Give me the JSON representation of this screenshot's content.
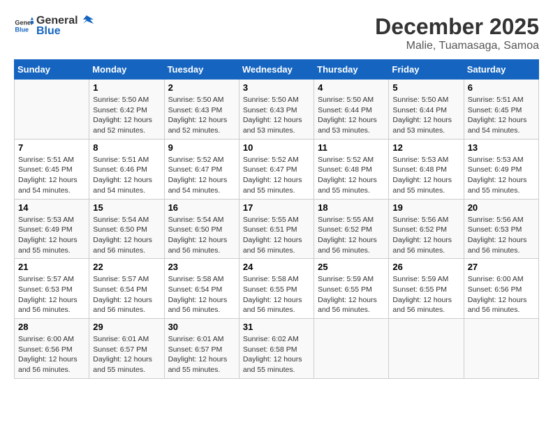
{
  "logo": {
    "text_general": "General",
    "text_blue": "Blue"
  },
  "title": "December 2025",
  "subtitle": "Malie, Tuamasaga, Samoa",
  "days_header": [
    "Sunday",
    "Monday",
    "Tuesday",
    "Wednesday",
    "Thursday",
    "Friday",
    "Saturday"
  ],
  "weeks": [
    [
      {
        "day": "",
        "info": ""
      },
      {
        "day": "1",
        "info": "Sunrise: 5:50 AM\nSunset: 6:42 PM\nDaylight: 12 hours\nand 52 minutes."
      },
      {
        "day": "2",
        "info": "Sunrise: 5:50 AM\nSunset: 6:43 PM\nDaylight: 12 hours\nand 52 minutes."
      },
      {
        "day": "3",
        "info": "Sunrise: 5:50 AM\nSunset: 6:43 PM\nDaylight: 12 hours\nand 53 minutes."
      },
      {
        "day": "4",
        "info": "Sunrise: 5:50 AM\nSunset: 6:44 PM\nDaylight: 12 hours\nand 53 minutes."
      },
      {
        "day": "5",
        "info": "Sunrise: 5:50 AM\nSunset: 6:44 PM\nDaylight: 12 hours\nand 53 minutes."
      },
      {
        "day": "6",
        "info": "Sunrise: 5:51 AM\nSunset: 6:45 PM\nDaylight: 12 hours\nand 54 minutes."
      }
    ],
    [
      {
        "day": "7",
        "info": "Sunrise: 5:51 AM\nSunset: 6:45 PM\nDaylight: 12 hours\nand 54 minutes."
      },
      {
        "day": "8",
        "info": "Sunrise: 5:51 AM\nSunset: 6:46 PM\nDaylight: 12 hours\nand 54 minutes."
      },
      {
        "day": "9",
        "info": "Sunrise: 5:52 AM\nSunset: 6:47 PM\nDaylight: 12 hours\nand 54 minutes."
      },
      {
        "day": "10",
        "info": "Sunrise: 5:52 AM\nSunset: 6:47 PM\nDaylight: 12 hours\nand 55 minutes."
      },
      {
        "day": "11",
        "info": "Sunrise: 5:52 AM\nSunset: 6:48 PM\nDaylight: 12 hours\nand 55 minutes."
      },
      {
        "day": "12",
        "info": "Sunrise: 5:53 AM\nSunset: 6:48 PM\nDaylight: 12 hours\nand 55 minutes."
      },
      {
        "day": "13",
        "info": "Sunrise: 5:53 AM\nSunset: 6:49 PM\nDaylight: 12 hours\nand 55 minutes."
      }
    ],
    [
      {
        "day": "14",
        "info": "Sunrise: 5:53 AM\nSunset: 6:49 PM\nDaylight: 12 hours\nand 55 minutes."
      },
      {
        "day": "15",
        "info": "Sunrise: 5:54 AM\nSunset: 6:50 PM\nDaylight: 12 hours\nand 56 minutes."
      },
      {
        "day": "16",
        "info": "Sunrise: 5:54 AM\nSunset: 6:50 PM\nDaylight: 12 hours\nand 56 minutes."
      },
      {
        "day": "17",
        "info": "Sunrise: 5:55 AM\nSunset: 6:51 PM\nDaylight: 12 hours\nand 56 minutes."
      },
      {
        "day": "18",
        "info": "Sunrise: 5:55 AM\nSunset: 6:52 PM\nDaylight: 12 hours\nand 56 minutes."
      },
      {
        "day": "19",
        "info": "Sunrise: 5:56 AM\nSunset: 6:52 PM\nDaylight: 12 hours\nand 56 minutes."
      },
      {
        "day": "20",
        "info": "Sunrise: 5:56 AM\nSunset: 6:53 PM\nDaylight: 12 hours\nand 56 minutes."
      }
    ],
    [
      {
        "day": "21",
        "info": "Sunrise: 5:57 AM\nSunset: 6:53 PM\nDaylight: 12 hours\nand 56 minutes."
      },
      {
        "day": "22",
        "info": "Sunrise: 5:57 AM\nSunset: 6:54 PM\nDaylight: 12 hours\nand 56 minutes."
      },
      {
        "day": "23",
        "info": "Sunrise: 5:58 AM\nSunset: 6:54 PM\nDaylight: 12 hours\nand 56 minutes."
      },
      {
        "day": "24",
        "info": "Sunrise: 5:58 AM\nSunset: 6:55 PM\nDaylight: 12 hours\nand 56 minutes."
      },
      {
        "day": "25",
        "info": "Sunrise: 5:59 AM\nSunset: 6:55 PM\nDaylight: 12 hours\nand 56 minutes."
      },
      {
        "day": "26",
        "info": "Sunrise: 5:59 AM\nSunset: 6:55 PM\nDaylight: 12 hours\nand 56 minutes."
      },
      {
        "day": "27",
        "info": "Sunrise: 6:00 AM\nSunset: 6:56 PM\nDaylight: 12 hours\nand 56 minutes."
      }
    ],
    [
      {
        "day": "28",
        "info": "Sunrise: 6:00 AM\nSunset: 6:56 PM\nDaylight: 12 hours\nand 56 minutes."
      },
      {
        "day": "29",
        "info": "Sunrise: 6:01 AM\nSunset: 6:57 PM\nDaylight: 12 hours\nand 55 minutes."
      },
      {
        "day": "30",
        "info": "Sunrise: 6:01 AM\nSunset: 6:57 PM\nDaylight: 12 hours\nand 55 minutes."
      },
      {
        "day": "31",
        "info": "Sunrise: 6:02 AM\nSunset: 6:58 PM\nDaylight: 12 hours\nand 55 minutes."
      },
      {
        "day": "",
        "info": ""
      },
      {
        "day": "",
        "info": ""
      },
      {
        "day": "",
        "info": ""
      }
    ]
  ]
}
